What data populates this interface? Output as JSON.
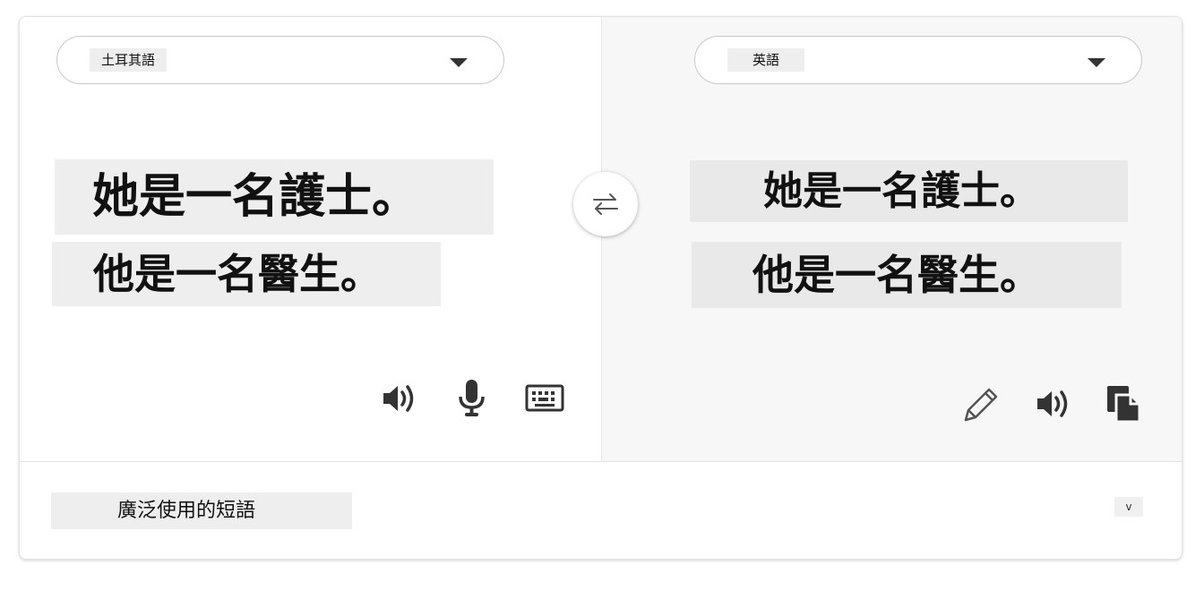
{
  "source": {
    "language": "土耳其語",
    "lines": [
      "她是一名護士。",
      "他是一名醫生。"
    ]
  },
  "target": {
    "language": "英語",
    "lines": [
      "她是一名護士。",
      "他是一名醫生。"
    ]
  },
  "icons": {
    "swap": "swap-arrows-icon",
    "source_speak": "speaker-icon",
    "source_mic": "microphone-icon",
    "source_keyboard": "keyboard-icon",
    "target_edit": "pencil-icon",
    "target_speak": "speaker-icon",
    "target_copy": "copy-icon"
  },
  "footer": {
    "phrases_label": "廣泛使用的短語",
    "expand_label": "v"
  }
}
